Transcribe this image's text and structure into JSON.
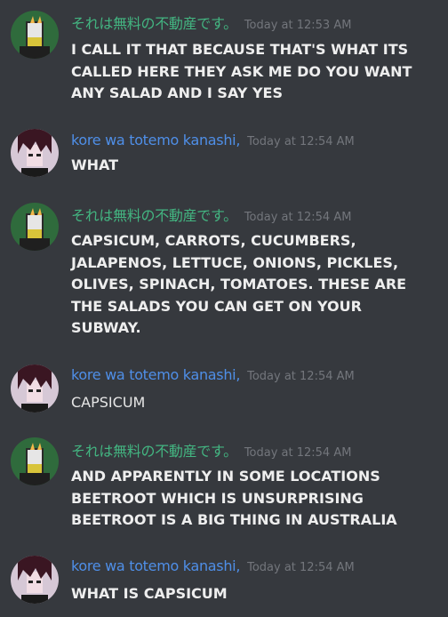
{
  "messages": [
    {
      "author": "それは無料の不動産です。",
      "timestamp": "Today at 12:53 AM",
      "text": "I CALL IT THAT BECAUSE THAT'S WHAT ITS CALLED HERE THEY ASK ME DO YOU WANT ANY SALAD AND I SAY YES"
    },
    {
      "author": "kore wa totemo kanashi,",
      "timestamp": "Today at 12:54 AM",
      "text": "WHAT"
    },
    {
      "author": "それは無料の不動産です。",
      "timestamp": "Today at 12:54 AM",
      "text": "CAPSICUM, CARROTS, CUCUMBERS, JALAPENOS, LETTUCE, ONIONS, PICKLES, OLIVES, SPINACH, TOMATOES. THESE ARE THE SALADS YOU CAN GET ON YOUR SUBWAY."
    },
    {
      "author": "kore wa totemo kanashi,",
      "timestamp": "Today at 12:54 AM",
      "text": "CAPSICUM"
    },
    {
      "author": "それは無料の不動産です。",
      "timestamp": "Today at 12:54 AM",
      "text": "AND APPARENTLY IN SOME LOCATIONS BEETROOT WHICH IS UNSURPRISING BEETROOT IS A BIG THING IN AUSTRALIA"
    },
    {
      "author": "kore wa totemo kanashi,",
      "timestamp": "Today at 12:54 AM",
      "text": "WHAT IS CAPSICUM"
    }
  ],
  "colors": {
    "background": "#36393e",
    "user_green": "#43b581",
    "user_blue": "#4f8fe8",
    "timestamp": "#73767c"
  }
}
